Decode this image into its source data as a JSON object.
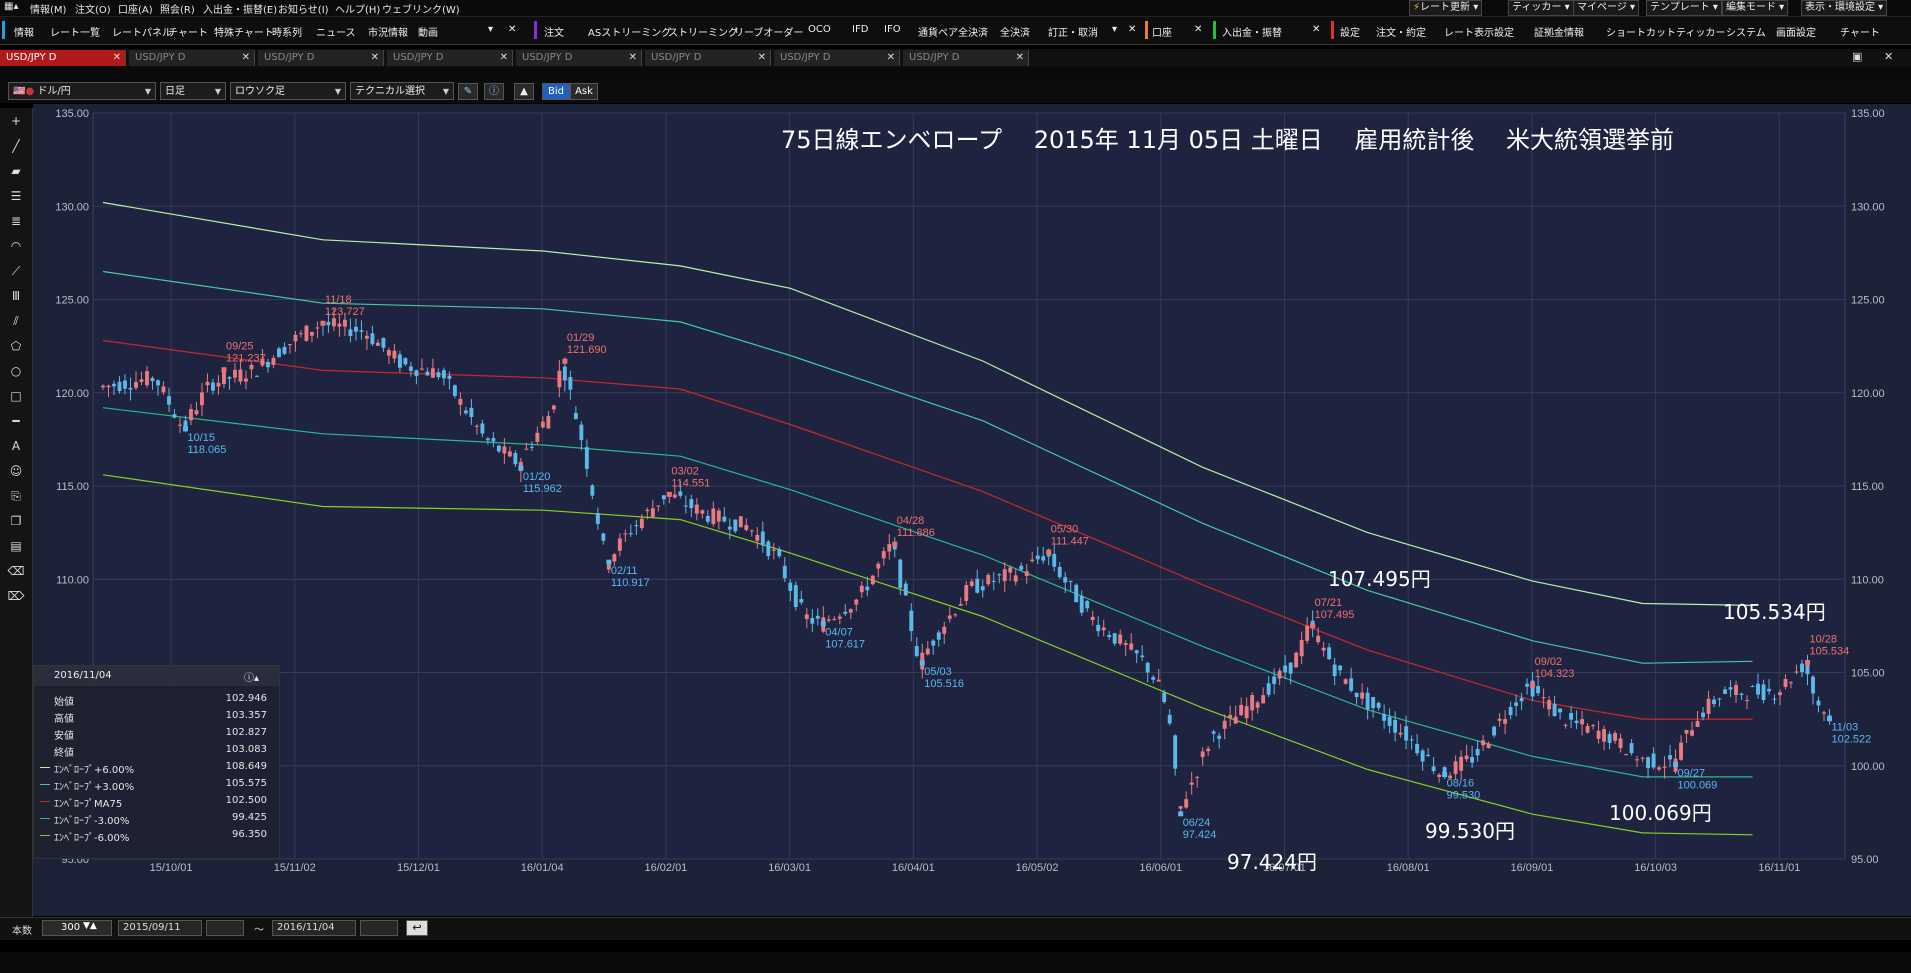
{
  "menu": {
    "items": [
      "情報(M)",
      "注文(O)",
      "口座(A)",
      "照会(R)",
      "入出金・振替(E)",
      "お知らせ(I)",
      "ヘルプ(H)",
      "ウェブリンク(W)"
    ],
    "right_buttons": [
      "レート更新",
      "ティッカー",
      "マイページ",
      "テンプレート",
      "編集モード",
      "表示・環境設定"
    ]
  },
  "toolbar": {
    "items_left": [
      "情報",
      "レート一覧",
      "レートパネル",
      "チャート",
      "特殊チャート",
      "時系列",
      "ニュース",
      "市況情報",
      "動画"
    ],
    "items_order": [
      "注文",
      "ASストリーミング",
      "ストリーミング",
      "リーブオーダー",
      "OCO",
      "IFD",
      "IFO",
      "通貨ペア全決済",
      "全決済",
      "訂正・取消"
    ],
    "items_account": [
      "口座"
    ],
    "items_transfer": [
      "入出金・振替"
    ],
    "items_settings": [
      "設定",
      "注文・約定",
      "レート表示設定",
      "証拠金情報",
      "ショートカット",
      "ティッカー",
      "システム",
      "画面設定",
      "チャート"
    ]
  },
  "tabs": [
    "USD/JPY D",
    "USD/JPY D",
    "USD/JPY D",
    "USD/JPY D",
    "USD/JPY D",
    "USD/JPY D",
    "USD/JPY D",
    "USD/JPY D"
  ],
  "controls": {
    "pair": "ドル/円",
    "period": "日足",
    "chart_style": "ロウソク足",
    "technical": "テクニカル選択",
    "bid": "Bid",
    "ask": "Ask"
  },
  "chart_data": {
    "type": "candlestick",
    "title": "75日線エンベロープ　 2015年 11月 05日 土曜日　 雇用統計後　 米大統領選挙前",
    "ylim": [
      95,
      135
    ],
    "y_ticks": [
      "135.00",
      "130.00",
      "125.00",
      "120.00",
      "115.00",
      "110.00",
      "105.00",
      "100.00",
      "95.00"
    ],
    "x_ticks": [
      "15/10/01",
      "15/11/02",
      "15/12/01",
      "16/01/04",
      "16/02/01",
      "16/03/01",
      "16/04/01",
      "16/05/02",
      "16/06/01",
      "16/07/01",
      "16/08/01",
      "16/09/01",
      "16/10/03",
      "16/11/01"
    ],
    "series": [
      {
        "name": "エンベロープ+6.00%",
        "color": "#b8f0a8",
        "x": [
          0,
          40,
          80,
          105,
          125,
          160,
          200,
          230,
          260,
          280,
          300
        ],
        "y": [
          130.2,
          128.2,
          127.6,
          126.8,
          125.6,
          121.7,
          116.0,
          112.5,
          109.9,
          108.7,
          108.6
        ]
      },
      {
        "name": "エンベロープ+3.00%",
        "color": "#46c8a0",
        "x": [
          0,
          40,
          80,
          105,
          125,
          160,
          200,
          230,
          260,
          280,
          300
        ],
        "y": [
          126.5,
          124.8,
          124.5,
          123.8,
          122.0,
          118.5,
          113.0,
          109.4,
          106.7,
          105.5,
          105.6
        ]
      },
      {
        "name": "エンベロープMA75",
        "color": "#c82828",
        "x": [
          0,
          40,
          80,
          105,
          125,
          160,
          200,
          230,
          260,
          280,
          300
        ],
        "y": [
          122.8,
          121.2,
          120.8,
          120.2,
          118.3,
          114.7,
          109.7,
          106.2,
          103.5,
          102.5,
          102.5
        ]
      },
      {
        "name": "エンベロープ-3.00%",
        "color": "#28b890",
        "x": [
          0,
          40,
          80,
          105,
          125,
          160,
          200,
          230,
          260,
          280,
          300
        ],
        "y": [
          119.2,
          117.8,
          117.2,
          116.6,
          114.8,
          111.3,
          106.4,
          103.0,
          100.5,
          99.4,
          99.4
        ]
      },
      {
        "name": "エンベロープ-6.00%",
        "color": "#88d020",
        "x": [
          0,
          40,
          80,
          105,
          125,
          160,
          200,
          230,
          260,
          280,
          300
        ],
        "y": [
          115.6,
          113.9,
          113.7,
          113.2,
          111.4,
          108.0,
          103.1,
          99.8,
          97.4,
          96.4,
          96.3
        ]
      }
    ],
    "price_path": [
      [
        0,
        120.3
      ],
      [
        10,
        120.8
      ],
      [
        15,
        118.1
      ],
      [
        20,
        120.5
      ],
      [
        28,
        121.2
      ],
      [
        35,
        122.8
      ],
      [
        40,
        123.7
      ],
      [
        48,
        123.3
      ],
      [
        55,
        121.5
      ],
      [
        62,
        121.0
      ],
      [
        70,
        117.5
      ],
      [
        76,
        116.2
      ],
      [
        82,
        119.0
      ],
      [
        84,
        121.7
      ],
      [
        88,
        117.0
      ],
      [
        92,
        110.9
      ],
      [
        96,
        112.5
      ],
      [
        103,
        114.6
      ],
      [
        110,
        113.5
      ],
      [
        118,
        112.8
      ],
      [
        123,
        111.2
      ],
      [
        128,
        108.0
      ],
      [
        131,
        107.6
      ],
      [
        138,
        109.0
      ],
      [
        144,
        111.9
      ],
      [
        149,
        105.5
      ],
      [
        152,
        107.0
      ],
      [
        158,
        109.5
      ],
      [
        168,
        110.5
      ],
      [
        172,
        111.4
      ],
      [
        180,
        108.0
      ],
      [
        190,
        105.5
      ],
      [
        193,
        104.0
      ],
      [
        195,
        101.5
      ],
      [
        196,
        97.4
      ],
      [
        202,
        101.5
      ],
      [
        210,
        103.5
      ],
      [
        217,
        105.5
      ],
      [
        220,
        107.5
      ],
      [
        225,
        105.0
      ],
      [
        230,
        103.5
      ],
      [
        238,
        101.5
      ],
      [
        244,
        99.5
      ],
      [
        250,
        100.5
      ],
      [
        256,
        103.0
      ],
      [
        260,
        104.3
      ],
      [
        266,
        102.5
      ],
      [
        275,
        101.5
      ],
      [
        280,
        100.3
      ],
      [
        286,
        100.1
      ],
      [
        290,
        102.5
      ],
      [
        295,
        103.9
      ],
      [
        305,
        104.0
      ],
      [
        310,
        105.5
      ],
      [
        312,
        103.5
      ],
      [
        315,
        102.5
      ]
    ],
    "annotations": [
      {
        "date": "09/25",
        "price": "121.237",
        "side": "high"
      },
      {
        "date": "10/15",
        "price": "118.065",
        "side": "low"
      },
      {
        "date": "11/18",
        "price": "123.727",
        "side": "high"
      },
      {
        "date": "01/20",
        "price": "115.962",
        "side": "low"
      },
      {
        "date": "01/29",
        "price": "121.690",
        "side": "high"
      },
      {
        "date": "02/11",
        "price": "110.917",
        "side": "low"
      },
      {
        "date": "03/02",
        "price": "114.551",
        "side": "high"
      },
      {
        "date": "04/07",
        "price": "107.617",
        "side": "low"
      },
      {
        "date": "04/28",
        "price": "111.886",
        "side": "high"
      },
      {
        "date": "05/03",
        "price": "105.516",
        "side": "low"
      },
      {
        "date": "05/30",
        "price": "111.447",
        "side": "high"
      },
      {
        "date": "06/24",
        "price": "97.424",
        "side": "low"
      },
      {
        "date": "07/21",
        "price": "107.495",
        "side": "high"
      },
      {
        "date": "08/16",
        "price": "99.530",
        "side": "low"
      },
      {
        "date": "09/02",
        "price": "104.323",
        "side": "high"
      },
      {
        "date": "09/27",
        "price": "100.069",
        "side": "low"
      },
      {
        "date": "10/28",
        "price": "105.534",
        "side": "high"
      },
      {
        "date": "11/03",
        "price": "102.522",
        "side": "low"
      }
    ],
    "big_labels": [
      "107.495円",
      "105.534円",
      "99.530円",
      "100.069円",
      "97.424円"
    ]
  },
  "info_panel": {
    "date": "2016/11/04",
    "rows": [
      {
        "label": "始値",
        "value": "102.946",
        "color": ""
      },
      {
        "label": "高値",
        "value": "103.357",
        "color": ""
      },
      {
        "label": "安値",
        "value": "102.827",
        "color": ""
      },
      {
        "label": "終値",
        "value": "103.083",
        "color": ""
      },
      {
        "label": "ｴﾝﾍﾞﾛｰﾌﾟ+6.00%",
        "value": "108.649",
        "color": "#b8f0a8"
      },
      {
        "label": "ｴﾝﾍﾞﾛｰﾌﾟ+3.00%",
        "value": "105.575",
        "color": "#46c8a0"
      },
      {
        "label": "ｴﾝﾍﾞﾛｰﾌﾟMA75",
        "value": "102.500",
        "color": "#c82828"
      },
      {
        "label": "ｴﾝﾍﾞﾛｰﾌﾟ-3.00%",
        "value": "99.425",
        "color": "#28b890"
      },
      {
        "label": "ｴﾝﾍﾞﾛｰﾌﾟ-6.00%",
        "value": "96.350",
        "color": "#88d020"
      }
    ]
  },
  "bottom": {
    "count_label": "本数",
    "count_value": "300",
    "from_date": "2015/09/11",
    "tilde": "～",
    "to_date": "2016/11/04"
  }
}
